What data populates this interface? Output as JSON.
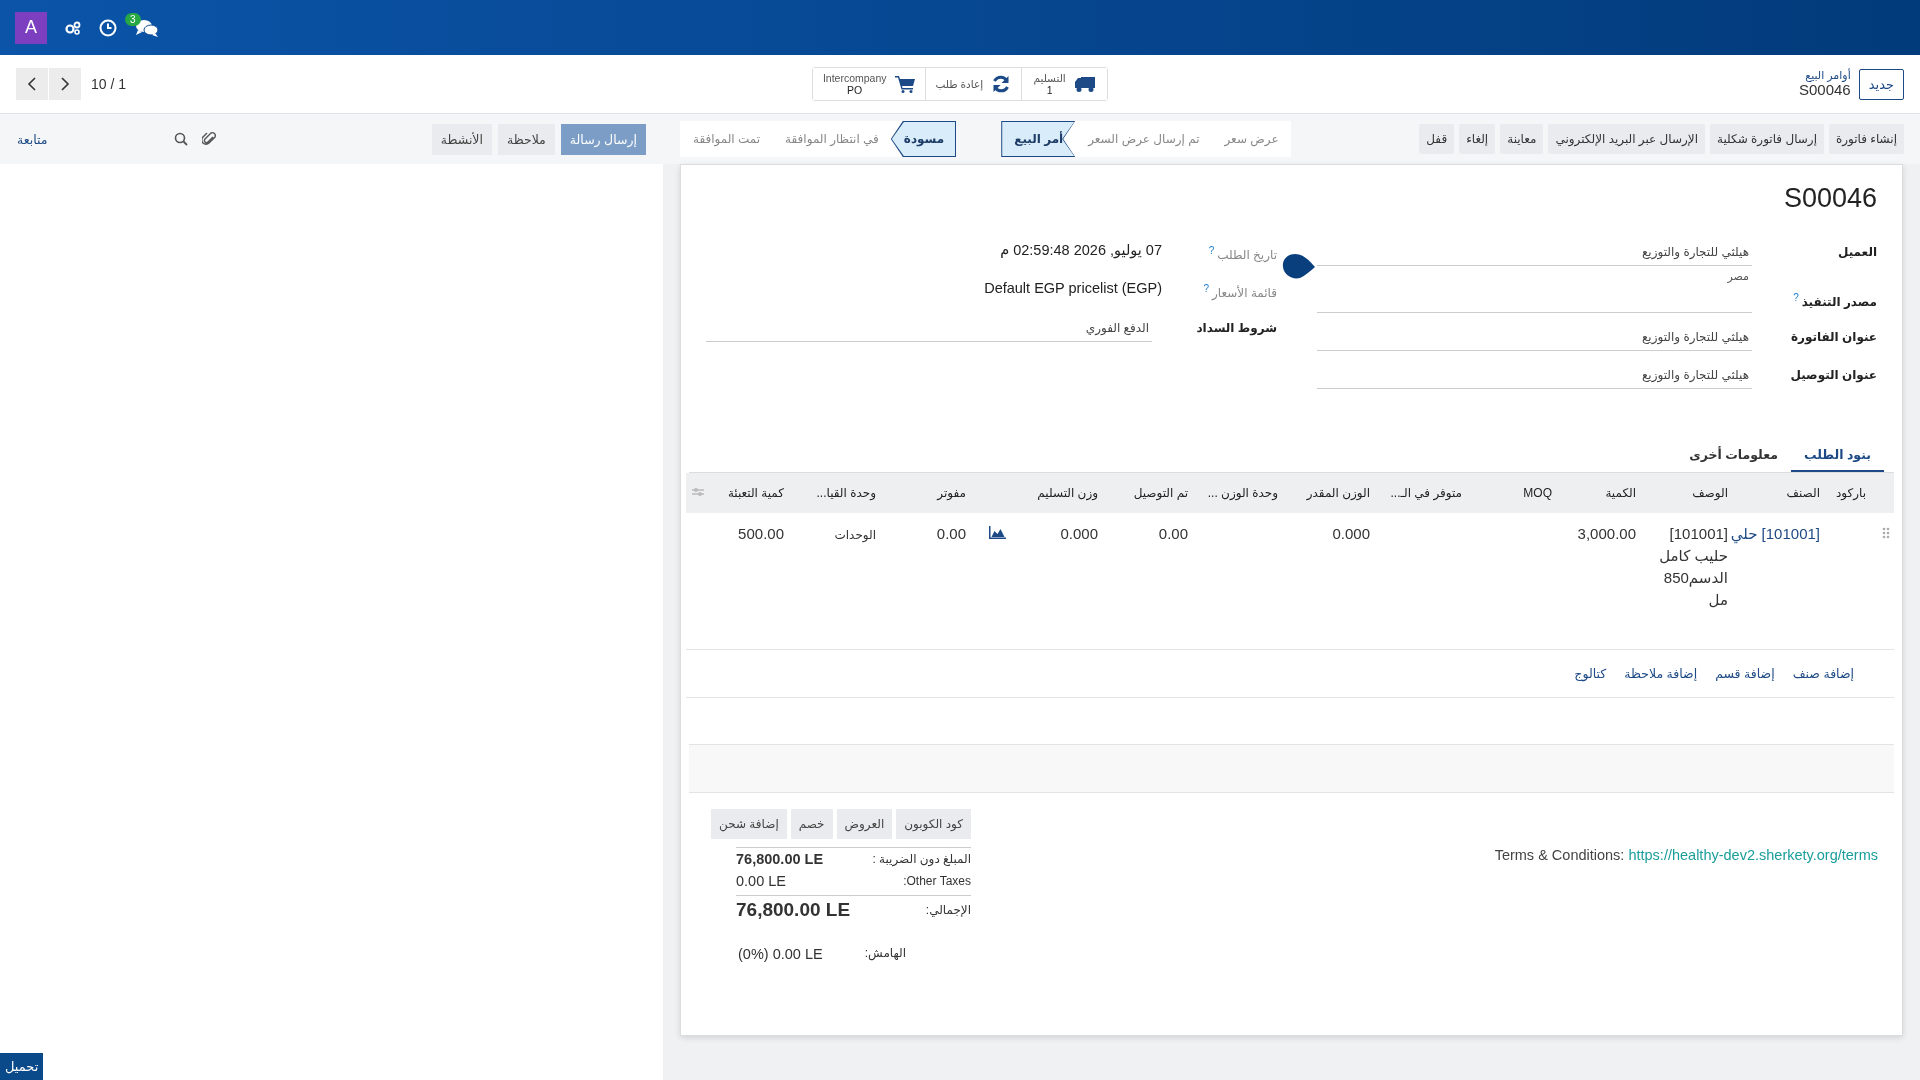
{
  "navbar": {
    "avatar": "A",
    "chat_badge": "3"
  },
  "control_panel": {
    "new_button": "جديد",
    "breadcrumb": "أوامر البيع",
    "record": "S00046",
    "pager": "10 / 1",
    "smart_buttons": [
      {
        "kind": "truck",
        "label": "التسليم",
        "value": "1"
      },
      {
        "kind": "refresh",
        "label": "إعادة طلب"
      },
      {
        "kind": "cart",
        "label": "Intercompany",
        "value": "PO"
      }
    ]
  },
  "actions": [
    "إنشاء فاتورة",
    "إرسال فاتورة شكلية",
    "الإرسال عبر البريد الإلكتروني",
    "معاينة",
    "إلغاء",
    "قفل"
  ],
  "statusbar": [
    {
      "label": "عرض سعر",
      "selected": false
    },
    {
      "label": "تم إرسال عرض السعر",
      "selected": false
    },
    {
      "label": "أمر البيع",
      "selected": true
    }
  ],
  "approval_statusbar": [
    {
      "label": "مسودة",
      "selected": true
    },
    {
      "label": "في انتظار الموافقة",
      "selected": false
    },
    {
      "label": "تمت الموافقة",
      "selected": false
    }
  ],
  "chatter": {
    "buttons": [
      {
        "label": "إرسال رسالة",
        "selected": true
      },
      {
        "label": "ملاحظة",
        "selected": false
      },
      {
        "label": "الأنشطة",
        "selected": false
      }
    ],
    "follow": "متابعة"
  },
  "form": {
    "title": "S00046",
    "right_fields": [
      {
        "label": "العميل",
        "value": "هيلثي للتجارة والتوزيع",
        "extra": "مصر"
      },
      {
        "label": "مصدر التنفيذ",
        "help": "?"
      },
      {
        "label": "عنوان الفاتورة",
        "value": "هيلثي للتجارة والتوزيع"
      },
      {
        "label": "عنوان التوصيل",
        "value": "هيلثي للتجارة والتوزيع"
      }
    ],
    "left_fields": [
      {
        "kind": "readonly",
        "label": "تاريخ الطلب",
        "help": "?",
        "value": "07 يوليو, 2026 02:59:48 م"
      },
      {
        "kind": "readonly",
        "label": "قائمة الأسعار",
        "help": "?",
        "value": "Default EGP pricelist (EGP)"
      },
      {
        "kind": "input",
        "label": "شروط السداد",
        "value": "الدفع الفوري"
      }
    ],
    "tabs": [
      {
        "label": "بنود الطلب",
        "selected": true
      },
      {
        "label": "معلومات أخرى",
        "selected": false
      }
    ],
    "table": {
      "columns": [
        {
          "kind": "handle"
        },
        {
          "kind": "text",
          "label": "باركود"
        },
        {
          "kind": "text",
          "label": "الصنف"
        },
        {
          "kind": "text",
          "label": "الوصف"
        },
        {
          "kind": "text",
          "label": "الكمية"
        },
        {
          "kind": "text",
          "label": "MOQ"
        },
        {
          "kind": "text",
          "label": "متوفر في الـ..."
        },
        {
          "kind": "text",
          "label": "الوزن المقدر"
        },
        {
          "kind": "text",
          "label": "وحدة الوزن ..."
        },
        {
          "kind": "text",
          "label": "تم التوصيل"
        },
        {
          "kind": "text",
          "label": "وزن التسليم"
        },
        {
          "kind": "blank"
        },
        {
          "kind": "text",
          "label": "مفوتر"
        },
        {
          "kind": "text",
          "label": "وحدة القيا..."
        },
        {
          "kind": "text",
          "label": "كمية التعبئة"
        },
        {
          "kind": "settings"
        }
      ],
      "rows": [
        {
          "cells": [
            {
              "kind": "handle"
            },
            {
              "kind": "empty"
            },
            {
              "kind": "link",
              "text": "[101001] حلي"
            },
            {
              "kind": "text",
              "text": "[101001] حليب كامل الدسم850 مل"
            },
            {
              "kind": "number",
              "text": "3,000.00"
            },
            {
              "kind": "empty"
            },
            {
              "kind": "empty"
            },
            {
              "kind": "number",
              "text": "0.000"
            },
            {
              "kind": "empty"
            },
            {
              "kind": "number",
              "text": "0.00"
            },
            {
              "kind": "number",
              "text": "0.000"
            },
            {
              "kind": "chart"
            },
            {
              "kind": "number",
              "text": "0.00"
            },
            {
              "kind": "small",
              "text": "الوحدات"
            },
            {
              "kind": "number",
              "text": "500.00"
            },
            {
              "kind": "empty"
            }
          ]
        }
      ],
      "add_links": [
        "إضافة صنف",
        "إضافة قسم",
        "إضافة ملاحظة",
        "كتالوج"
      ]
    },
    "footer_buttons": [
      "كود الكوبون",
      "العروض",
      "خصم",
      "إضافة شحن"
    ],
    "terms": {
      "label": "Terms & Conditions:",
      "link": "https://healthy-dev2.sherkety.org/terms"
    },
    "totals": [
      {
        "kind": "bold",
        "label": "المبلغ دون الضريبة :",
        "value": "76,800.00 LE"
      },
      {
        "kind": "plain",
        "label": "Other Taxes:",
        "value": "0.00 LE"
      },
      {
        "kind": "grand",
        "label": "الإجمالي:",
        "value": "76,800.00 LE"
      }
    ],
    "margin": {
      "label": "الهامش:",
      "value": "(0%) 0.00 LE"
    }
  },
  "loading": "تحميل"
}
